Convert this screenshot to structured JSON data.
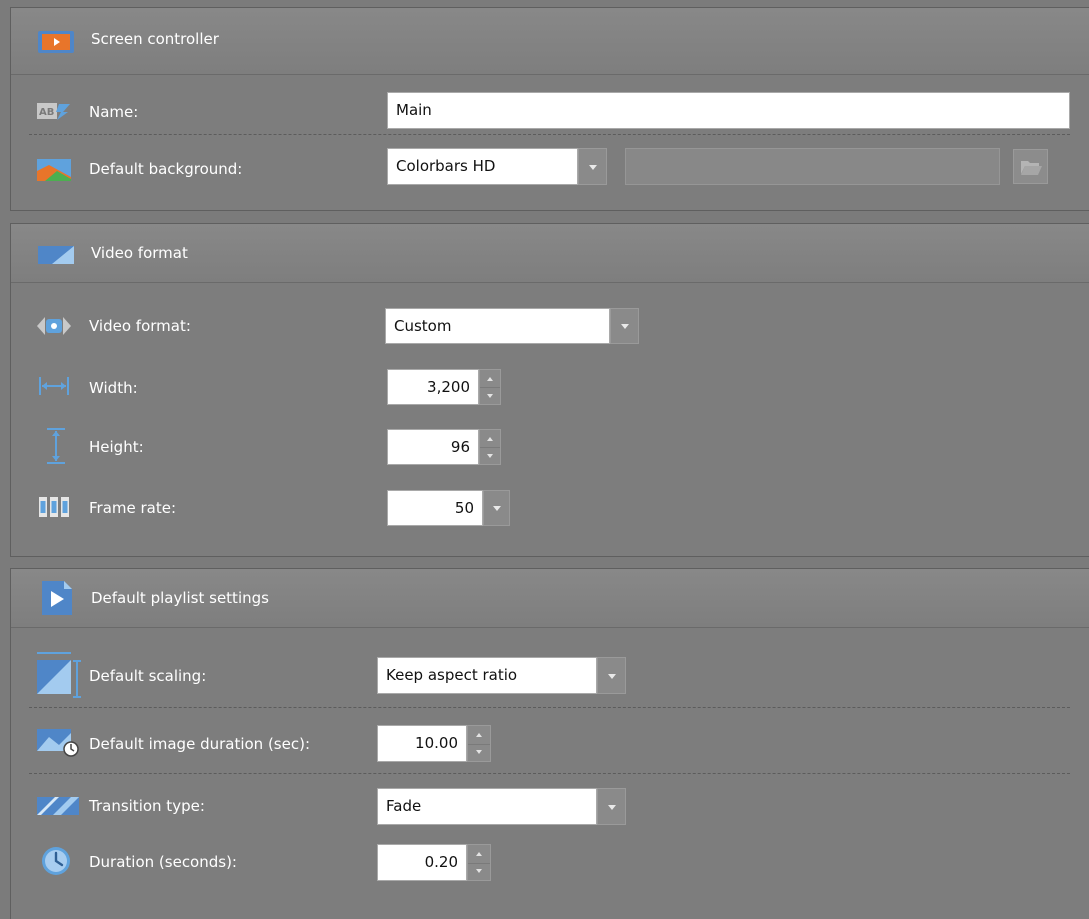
{
  "screen_controller": {
    "title": "Screen controller",
    "name_label": "Name:",
    "name_value": "Main",
    "bg_label": "Default background:",
    "bg_value": "Colorbars HD",
    "bg_path_value": ""
  },
  "video_format": {
    "title": "Video format",
    "format_label": "Video format:",
    "format_value": "Custom",
    "width_label": "Width:",
    "width_value": "3,200",
    "height_label": "Height:",
    "height_value": "96",
    "framerate_label": "Frame rate:",
    "framerate_value": "50"
  },
  "playlist": {
    "title": "Default playlist settings",
    "scaling_label": "Default scaling:",
    "scaling_value": "Keep aspect ratio",
    "image_duration_label": "Default image duration (sec):",
    "image_duration_value": "10.00",
    "transition_label": "Transition type:",
    "transition_value": "Fade",
    "duration_label": "Duration (seconds):",
    "duration_value": "0.20"
  },
  "colors": {
    "background": "#7b7b7b",
    "header": "#858585",
    "accent_orange": "#e8752a",
    "accent_blue": "#5fa2dd"
  },
  "icons": {
    "screen_controller": "screen-controller-icon",
    "name": "text-field-icon",
    "background": "image-icon",
    "video_format": "video-format-icon",
    "format": "video-camera-icon",
    "width": "width-icon",
    "height": "height-icon",
    "framerate": "film-frames-icon",
    "playlist": "play-icon",
    "scaling": "scaling-icon",
    "image_duration": "image-timer-icon",
    "transition": "transition-icon",
    "duration": "clock-icon",
    "browse": "folder-open-icon"
  }
}
